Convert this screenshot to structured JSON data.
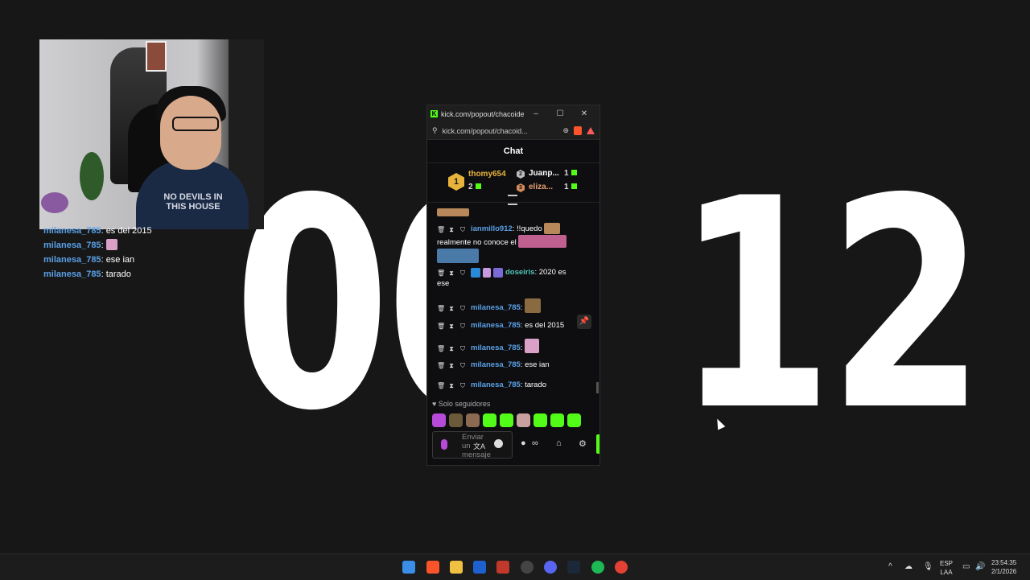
{
  "countdown": {
    "digits_left": "00",
    "digits_right": "12"
  },
  "webcam": {
    "shirt_text": "NO DEVILS IN THIS HOUSE"
  },
  "overlay_chat": [
    {
      "user": "milanesa_785",
      "text": "es del 2015",
      "emote": false
    },
    {
      "user": "milanesa_785",
      "text": "",
      "emote": true
    },
    {
      "user": "milanesa_785",
      "text": "ese ian",
      "emote": false
    },
    {
      "user": "milanesa_785",
      "text": "tarado",
      "emote": false
    }
  ],
  "window": {
    "title": "kick.com/popout/chacoide/...",
    "url": "kick.com/popout/chacoid...",
    "minimize": "–",
    "maximize": "☐",
    "close": "✕"
  },
  "chat": {
    "header": "Chat",
    "leaderboard": [
      {
        "rank": "1",
        "name": "thomy654",
        "count": "2"
      },
      {
        "rank": "2",
        "name": "Juanp...",
        "count": "1"
      },
      {
        "rank": "3",
        "name": "eliza...",
        "count": "1"
      }
    ],
    "messages": [
      {
        "user": "ianmillo912",
        "text": ": !!quedo",
        "text2": "realmente no conoce el"
      },
      {
        "user": "doseiris",
        "text": ": 2020 es",
        "text2": "ese"
      },
      {
        "user": "milanesa_785",
        "text": ":"
      },
      {
        "user": "milanesa_785",
        "text": ": es del 2015"
      },
      {
        "user": "milanesa_785",
        "text": ":"
      },
      {
        "user": "milanesa_785",
        "text": ": ese ian"
      },
      {
        "user": "milanesa_785",
        "text": ": tarado"
      }
    ],
    "followers_only": "Solo seguidores",
    "input_placeholder": "Enviar un mensaje",
    "emote_colors": [
      "#b84ad8",
      "#6b5a3a",
      "#8a6a50",
      "#53fc18",
      "#53fc18",
      "#c8a0a0",
      "#53fc18",
      "#53fc18",
      "#53fc18"
    ]
  },
  "taskbar": {
    "language": "ESP",
    "layout": "LAA",
    "time": "23:54:35",
    "date": "2/1/2026"
  }
}
